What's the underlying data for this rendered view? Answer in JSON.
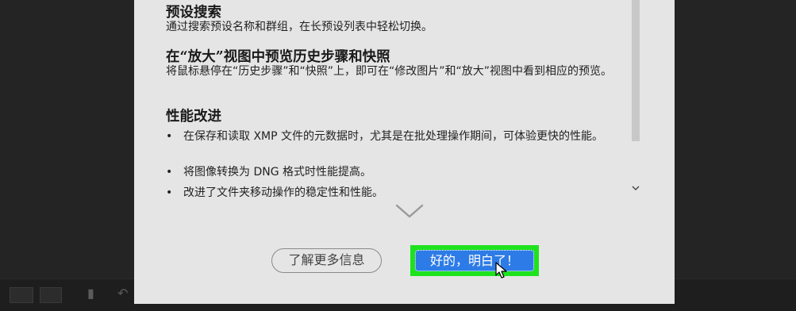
{
  "dialog": {
    "sections": [
      {
        "title": "预设搜索",
        "desc": "通过搜索预设名称和群组，在长预设列表中轻松切换。"
      },
      {
        "title": "在“放大”视图中预览历史步骤和快照",
        "desc": "将鼠标悬停在“历史步骤”和“快照”上，即可在“修改图片”和“放大”视图中看到相应的预览。"
      },
      {
        "title": "性能改进",
        "bullets": [
          "在保存和读取 XMP 文件的元数据时，尤其是在批处理操作期间，可体验更快的性能。",
          "将图像转换为 DNG 格式时性能提高。",
          "改进了文件夹移动操作的稳定性和性能。"
        ]
      }
    ],
    "bullet_char": "•",
    "learn_more_label": "了解更多信息",
    "ok_label": "好的，明白了！"
  },
  "colors": {
    "dialog_bg": "#e5e5e5",
    "primary_button": "#2d7be6",
    "highlight": "#1fe21f",
    "backdrop": "#232323"
  },
  "icons": {
    "scroll_down": "chevron-down-icon",
    "more": "chevron-down-icon",
    "cursor": "mouse-pointer-icon"
  }
}
